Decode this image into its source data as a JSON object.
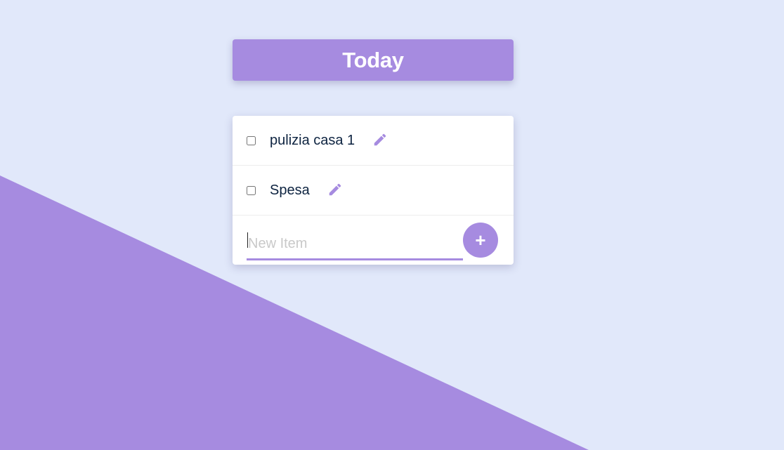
{
  "page": {
    "background_color": "#e1e8fa",
    "accent_color": "#a68be0"
  },
  "header": {
    "title": "Today"
  },
  "todo_list": {
    "items": [
      {
        "label": "pulizia casa 1",
        "checked": false,
        "edit_icon": "pencil-icon"
      },
      {
        "label": "Spesa",
        "checked": false,
        "edit_icon": "pencil-icon"
      }
    ],
    "new_item": {
      "placeholder": "New Item",
      "value": ""
    },
    "add_button_label": "+"
  }
}
